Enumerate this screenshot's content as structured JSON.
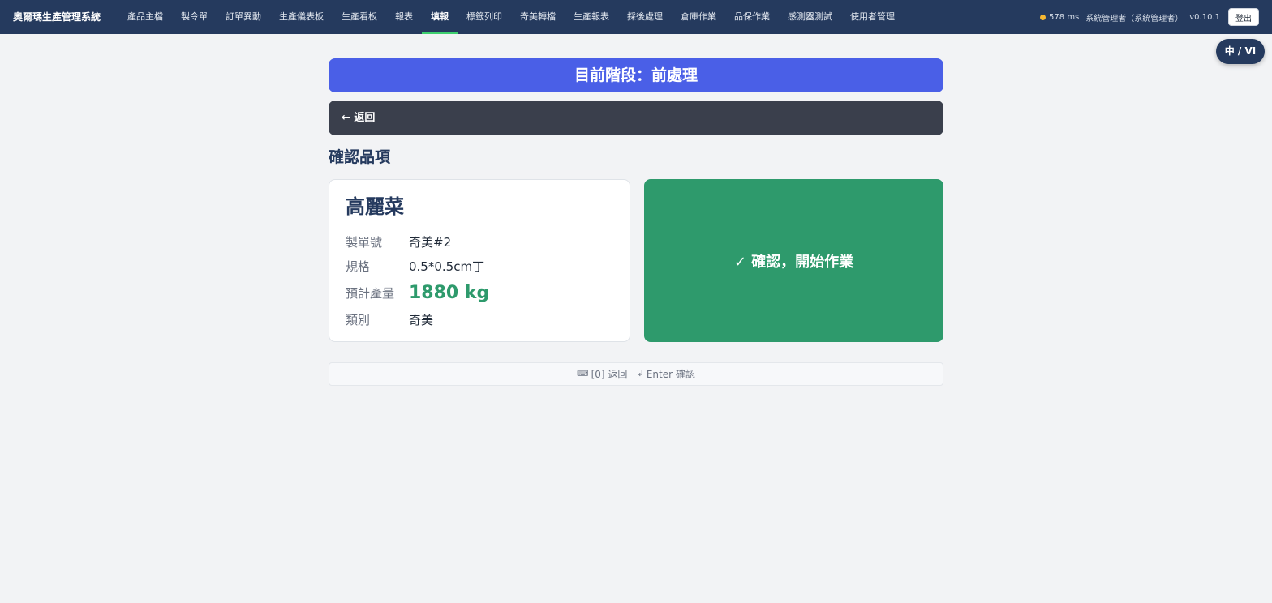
{
  "app": {
    "title": "奧爾瑪生產管理系統"
  },
  "nav": {
    "items": [
      {
        "label": "產品主檔"
      },
      {
        "label": "製令單"
      },
      {
        "label": "訂單異動"
      },
      {
        "label": "生產儀表板"
      },
      {
        "label": "生產看板"
      },
      {
        "label": "報表"
      },
      {
        "label": "填報",
        "active": true
      },
      {
        "label": "標籤列印"
      },
      {
        "label": "奇美轉檔"
      },
      {
        "label": "生產報表"
      },
      {
        "label": "採後處理"
      },
      {
        "label": "倉庫作業"
      },
      {
        "label": "品保作業"
      },
      {
        "label": "感測器測試"
      },
      {
        "label": "使用者管理"
      }
    ],
    "latency": "578 ms",
    "latency_status_color": "#f5b731",
    "user": "系統管理者（系統管理者）",
    "version": "v0.10.1",
    "logout_label": "登出"
  },
  "lang_toggle": "中 / VI",
  "stage": {
    "text": "目前階段：前處理"
  },
  "back": {
    "icon": "arrow-left-icon",
    "label": "← 返回"
  },
  "section": {
    "title": "確認品項"
  },
  "item": {
    "name": "高麗菜",
    "fields": [
      {
        "key": "製單號",
        "value": "奇美#2"
      },
      {
        "key": "規格",
        "value": "0.5*0.5cm丁"
      },
      {
        "key": "預計產量",
        "value": "1880 kg"
      },
      {
        "key": "類別",
        "value": "奇美"
      }
    ]
  },
  "confirm": {
    "label": "✓ 確認，開始作業"
  },
  "hints": [
    {
      "icon": "keyboard-icon",
      "glyph": "⌨",
      "text": "[0] 返回"
    },
    {
      "icon": "enter-key-icon",
      "glyph": "↲",
      "text": "Enter 確認"
    }
  ],
  "colors": {
    "nav_bg": "#253a5e",
    "stage_bg": "#4a5fe7",
    "back_bg": "#3a3f4c",
    "confirm_bg": "#2e9a6c",
    "active_underline": "#3ecf6f"
  }
}
